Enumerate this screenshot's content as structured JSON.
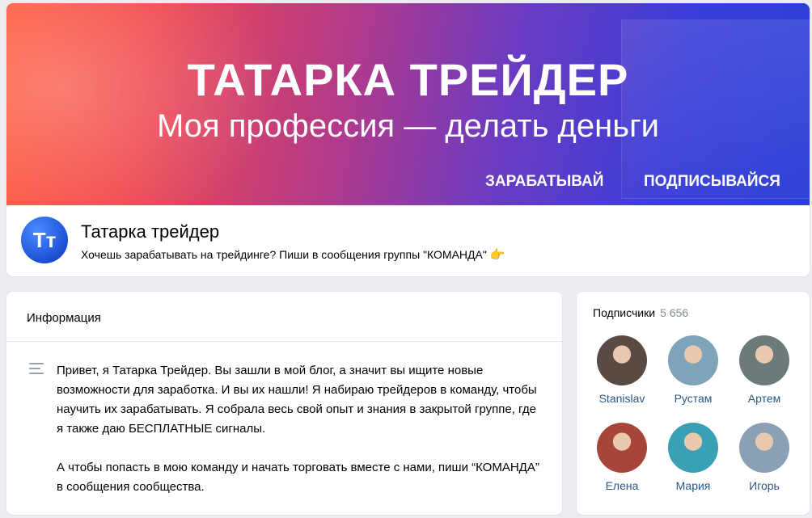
{
  "cover": {
    "title": "ТАТАРКА ТРЕЙДЕР",
    "subtitle": "Моя профессия — делать деньги",
    "cta_1": "ЗАРАБАТЫВАЙ",
    "cta_2": "ПОДПИСЫВАЙСЯ"
  },
  "group": {
    "avatar_text": "Тт",
    "name": "Татарка трейдер",
    "status": "Хочешь зарабатывать на трейдинге? Пиши в сообщения группы \"КОМАНДА\"",
    "status_emoji": "👉"
  },
  "info": {
    "heading": "Информация",
    "paragraph_1": "Привет, я Татарка Трейдер. Вы зашли в мой блог, а значит вы ищите новые возможности для заработка. И вы их нашли! Я набираю трейдеров в команду, чтобы научить их зарабатывать. Я собрала весь свой опыт и знания в закрытой группе, где я также даю БЕСПЛАТНЫЕ сигналы.",
    "paragraph_2": "А чтобы попасть в мою команду и начать торговать вместе с нами, пиши “КОМАНДА” в сообщения сообщества."
  },
  "subscribers": {
    "title": "Подписчики",
    "count": "5 656",
    "members": [
      {
        "name": "Stanislav",
        "color": "#5a4a44"
      },
      {
        "name": "Рустам",
        "color": "#7fa3b8"
      },
      {
        "name": "Артем",
        "color": "#6c7a7a"
      },
      {
        "name": "Елена",
        "color": "#a8453a"
      },
      {
        "name": "Мария",
        "color": "#3aa0b5"
      },
      {
        "name": "Игорь",
        "color": "#8aa0b4"
      }
    ]
  }
}
